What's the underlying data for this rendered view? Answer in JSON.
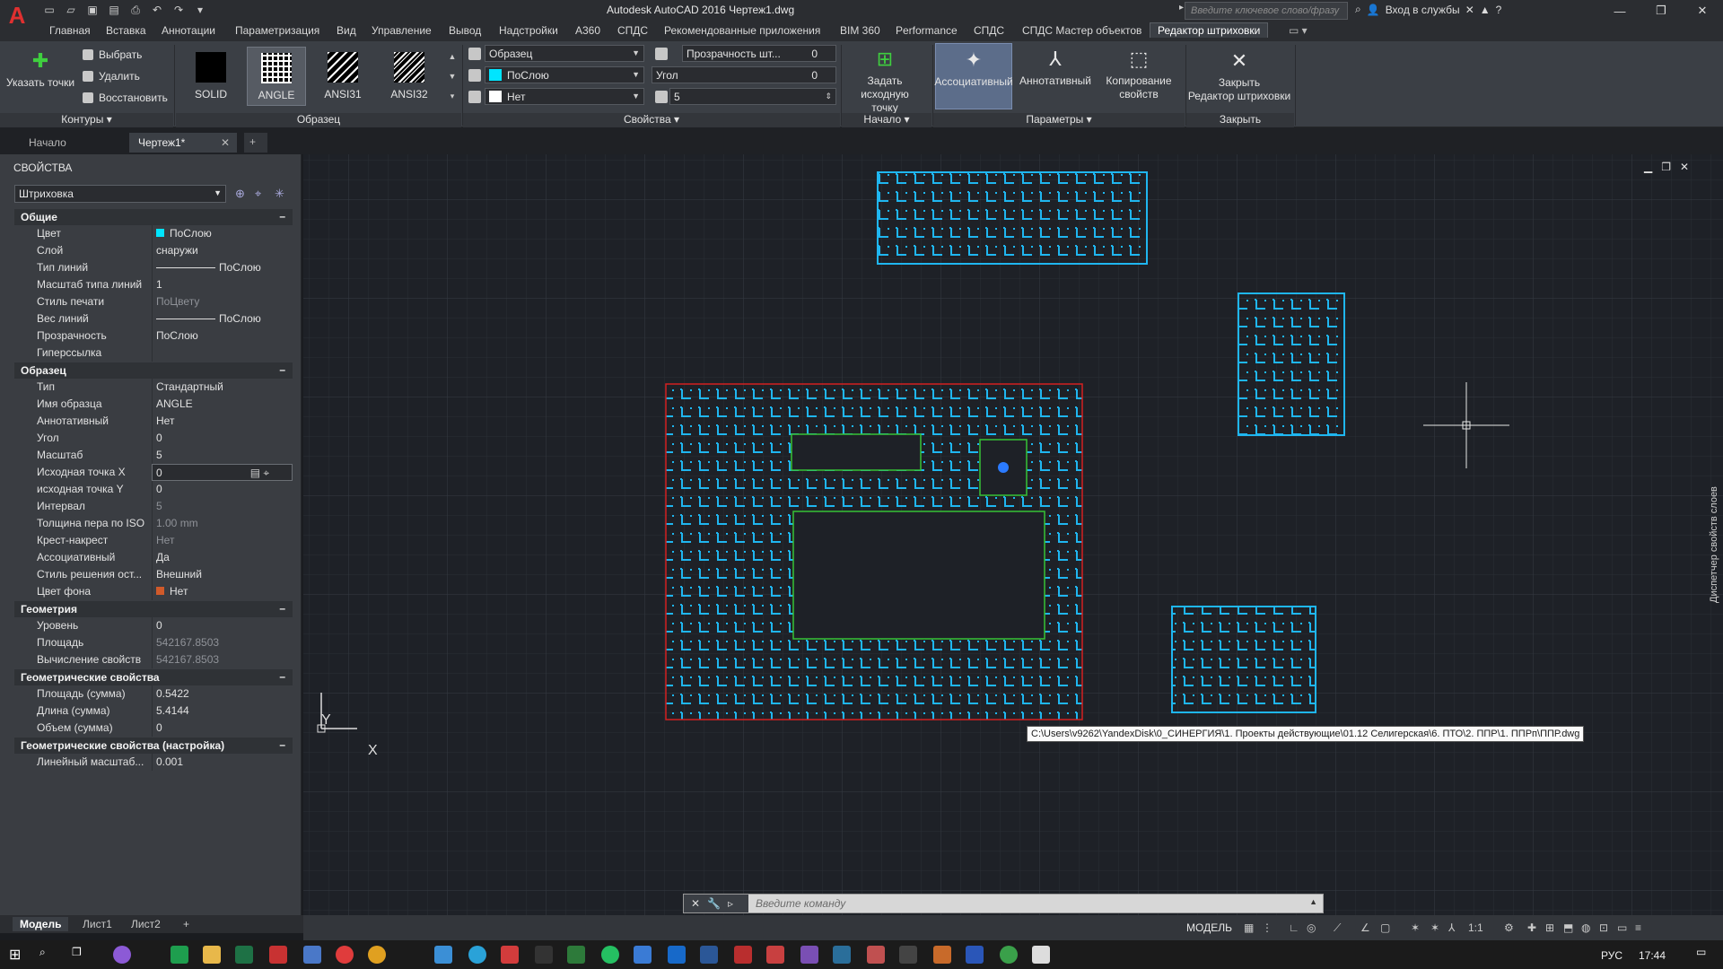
{
  "window": {
    "title": "Autodesk AutoCAD 2016    Чертеж1.dwg",
    "search_placeholder": "Введите ключевое слово/фразу",
    "signin": "Вход в службы",
    "logo": "A"
  },
  "menu_tabs": [
    "Главная",
    "Вставка",
    "Аннотации",
    "Параметризация",
    "Вид",
    "Управление",
    "Вывод",
    "Надстройки",
    "A360",
    "СПДС",
    "Рекомендованные приложения",
    "BIM 360",
    "Performance",
    "СПДС",
    "СПДС Мастер объектов",
    "Редактор штриховки"
  ],
  "ribbon": {
    "contours": {
      "pick_points": "Указать точки",
      "select": "Выбрать",
      "remove": "Удалить",
      "restore": "Восстановить",
      "label": "Контуры"
    },
    "pattern": {
      "swatches": [
        "SOLID",
        "ANGLE",
        "ANSI31",
        "ANSI32"
      ],
      "label": "Образец"
    },
    "properties": {
      "type": "Образец",
      "color": "ПоСлою",
      "background": "Нет",
      "transparency_label": "Прозрачность шт...",
      "transparency_value": "0",
      "angle_label": "Угол",
      "angle_value": "0",
      "scale_value": "5",
      "label": "Свойства"
    },
    "origin": {
      "set_origin": "Задать\nисходную точку",
      "label": "Начало"
    },
    "options": {
      "associative": "Ассоциативный",
      "annotative": "Аннотативный",
      "match": "Копирование\nсвойств",
      "label": "Параметры"
    },
    "close": {
      "close_editor": "Закрыть\nРедактор штриховки",
      "label": "Закрыть"
    }
  },
  "file_tabs": [
    "Начало",
    "Чертеж1*"
  ],
  "properties_palette": {
    "title": "СВОЙСТВА",
    "selection": "Штриховка",
    "sections": [
      {
        "name": "Общие",
        "rows": [
          {
            "k": "Цвет",
            "v": "ПоСлою"
          },
          {
            "k": "Слой",
            "v": "снаружи"
          },
          {
            "k": "Тип линий",
            "v": "ПоСлою"
          },
          {
            "k": "Масштаб типа линий",
            "v": "1"
          },
          {
            "k": "Стиль печати",
            "v": "ПоЦвету",
            "dim": true
          },
          {
            "k": "Вес линий",
            "v": "ПоСлою"
          },
          {
            "k": "Прозрачность",
            "v": "ПоСлою"
          },
          {
            "k": "Гиперссылка",
            "v": ""
          }
        ]
      },
      {
        "name": "Образец",
        "rows": [
          {
            "k": "Тип",
            "v": "Стандартный"
          },
          {
            "k": "Имя образца",
            "v": "ANGLE"
          },
          {
            "k": "Аннотативный",
            "v": "Нет"
          },
          {
            "k": "Угол",
            "v": "0"
          },
          {
            "k": "Масштаб",
            "v": "5"
          },
          {
            "k": "Исходная точка X",
            "v": "0",
            "hl": true
          },
          {
            "k": "исходная точка Y",
            "v": "0"
          },
          {
            "k": "Интервал",
            "v": "5",
            "dim": true
          },
          {
            "k": "Толщина пера по ISO",
            "v": "1.00 mm",
            "dim": true
          },
          {
            "k": "Крест-накрест",
            "v": "Нет",
            "dim": true
          },
          {
            "k": "Ассоциативный",
            "v": "Да"
          },
          {
            "k": "Стиль решения ост...",
            "v": "Внешний"
          },
          {
            "k": "Цвет фона",
            "v": "Нет"
          }
        ]
      },
      {
        "name": "Геометрия",
        "rows": [
          {
            "k": "Уровень",
            "v": "0"
          },
          {
            "k": "Площадь",
            "v": "542167.8503",
            "dim": true
          },
          {
            "k": "Вычисление свойств",
            "v": "542167.8503",
            "dim": true
          }
        ]
      },
      {
        "name": "Геометрические свойства",
        "rows": [
          {
            "k": "Площадь (сумма)",
            "v": "0.5422"
          },
          {
            "k": "Длина (сумма)",
            "v": "5.4144"
          },
          {
            "k": "Объем (сумма)",
            "v": "0"
          }
        ]
      },
      {
        "name": "Геометрические свойства (настройка)",
        "rows": [
          {
            "k": "Линейный масштаб...",
            "v": "0.001"
          }
        ]
      }
    ]
  },
  "canvas": {
    "path_tooltip": "C:\\Users\\v9262\\YandexDisk\\0_СИНЕРГИЯ\\1. Проекты действующие\\01.12 Селигерская\\6. ПТО\\2. ППР\\1. ППРп\\ППР.dwg",
    "layer_manager_label": "Диспетчер свойств слоев",
    "ucs_x": "X",
    "ucs_y": "Y",
    "hatch_color": "#1fb6f0",
    "boundary_red": "#d32020",
    "island_green": "#36c236"
  },
  "command_line": {
    "placeholder": "Введите команду"
  },
  "layout_tabs": [
    "Модель",
    "Лист1",
    "Лист2"
  ],
  "status": {
    "model": "МОДЕЛЬ",
    "scale": "1:1"
  },
  "taskbar": {
    "language": "РУС",
    "time": "17:44"
  }
}
